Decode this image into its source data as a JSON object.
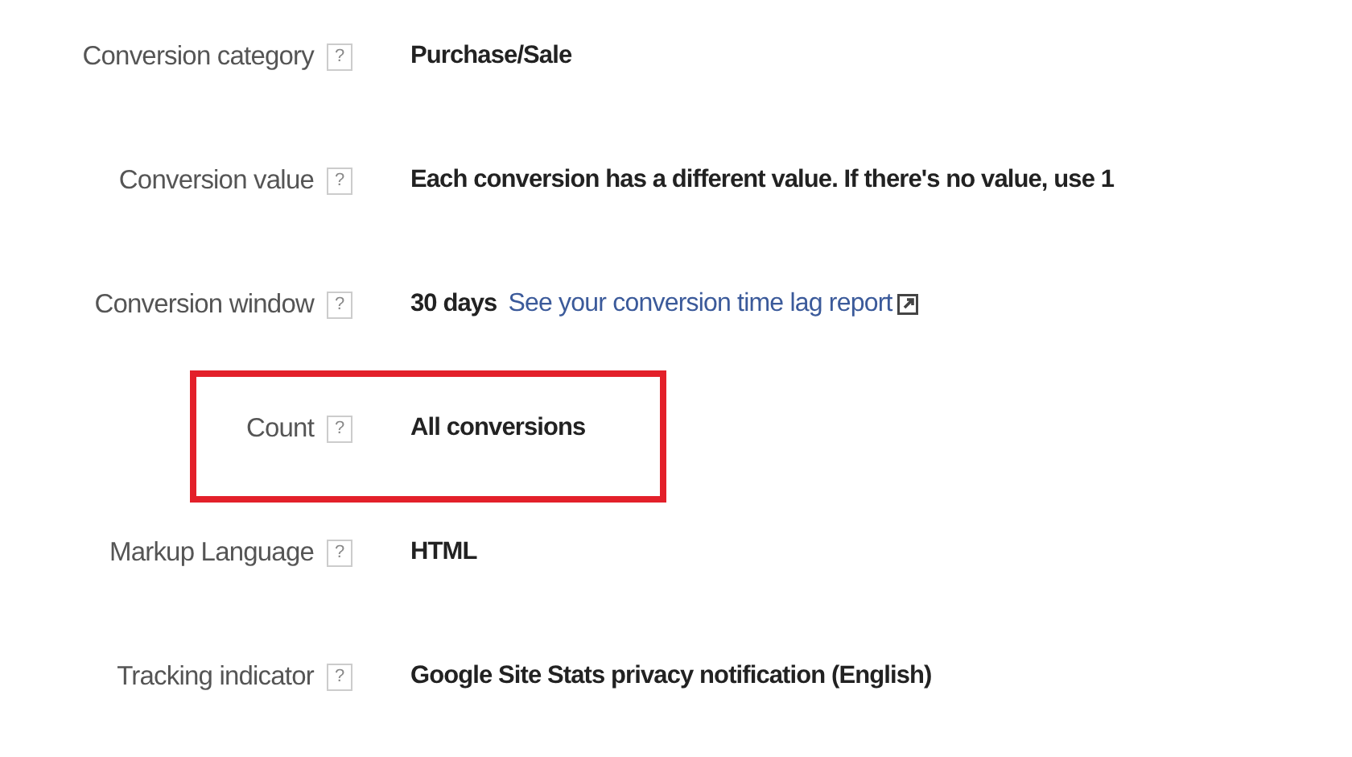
{
  "settings": [
    {
      "label": "Conversion category",
      "value": "Purchase/Sale",
      "highlighted": false
    },
    {
      "label": "Conversion value",
      "value": "Each conversion has a different value. If there's no value, use 1",
      "highlighted": false
    },
    {
      "label": "Conversion window",
      "value": "30 days",
      "link": "See your conversion time lag report",
      "highlighted": false
    },
    {
      "label": "Count",
      "value": "All conversions",
      "highlighted": true
    },
    {
      "label": "Markup Language",
      "value": "HTML",
      "highlighted": false
    },
    {
      "label": "Tracking indicator",
      "value": "Google Site Stats privacy notification (English)",
      "highlighted": false
    }
  ],
  "help_mark": "?"
}
